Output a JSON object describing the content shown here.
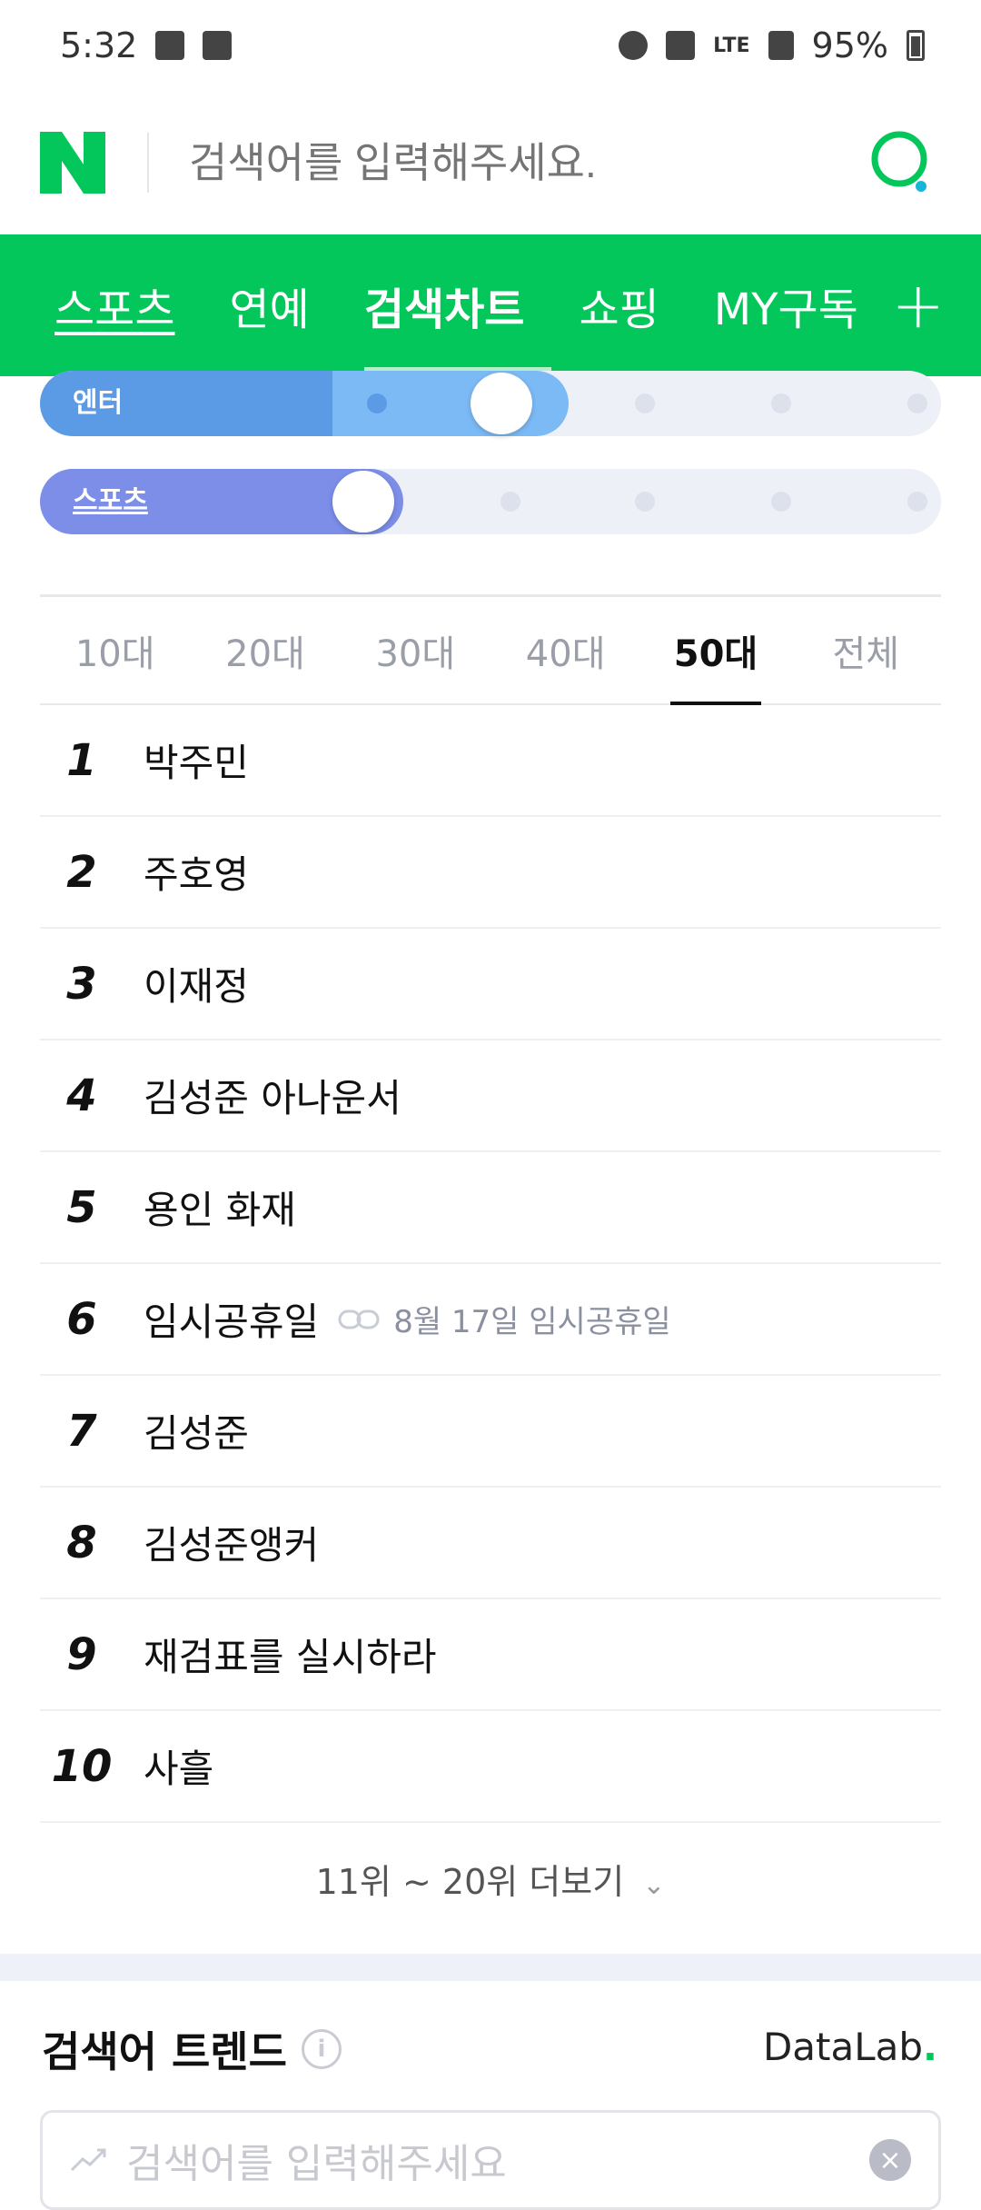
{
  "status_bar": {
    "time": "5:32",
    "battery": "95%",
    "network": "LTE"
  },
  "search": {
    "placeholder": "검색어를 입력해주세요."
  },
  "nav": {
    "tabs": [
      "스포츠",
      "연예",
      "검색차트",
      "쇼핑",
      "MY구독"
    ],
    "active": "검색차트",
    "plus": "+"
  },
  "filters": {
    "entertainment_label": "엔터",
    "sports_label": "스포츠",
    "entertainment_level": 2,
    "sports_level": 0
  },
  "age_tabs": {
    "items": [
      "10대",
      "20대",
      "30대",
      "40대",
      "50대",
      "전체"
    ],
    "active": "50대"
  },
  "rankings": [
    {
      "rank": "1",
      "term": "박주민"
    },
    {
      "rank": "2",
      "term": "주호영"
    },
    {
      "rank": "3",
      "term": "이재정"
    },
    {
      "rank": "4",
      "term": "김성준 아나운서"
    },
    {
      "rank": "5",
      "term": "용인 화재"
    },
    {
      "rank": "6",
      "term": "임시공휴일",
      "related": "8월 17일 임시공휴일"
    },
    {
      "rank": "7",
      "term": "김성준"
    },
    {
      "rank": "8",
      "term": "김성준앵커"
    },
    {
      "rank": "9",
      "term": "재검표를 실시하라"
    },
    {
      "rank": "10",
      "term": "사흘"
    }
  ],
  "more_label": "11위 ~ 20위 더보기",
  "trend": {
    "title": "검색어 트렌드",
    "brand": "DataLab",
    "brand_dot": ".",
    "placeholder": "검색어를 입력해주세요"
  },
  "colors": {
    "brand_green": "#03c75a",
    "enter_fill": "#5b9be6",
    "sports_fill": "#7c8ee8"
  }
}
